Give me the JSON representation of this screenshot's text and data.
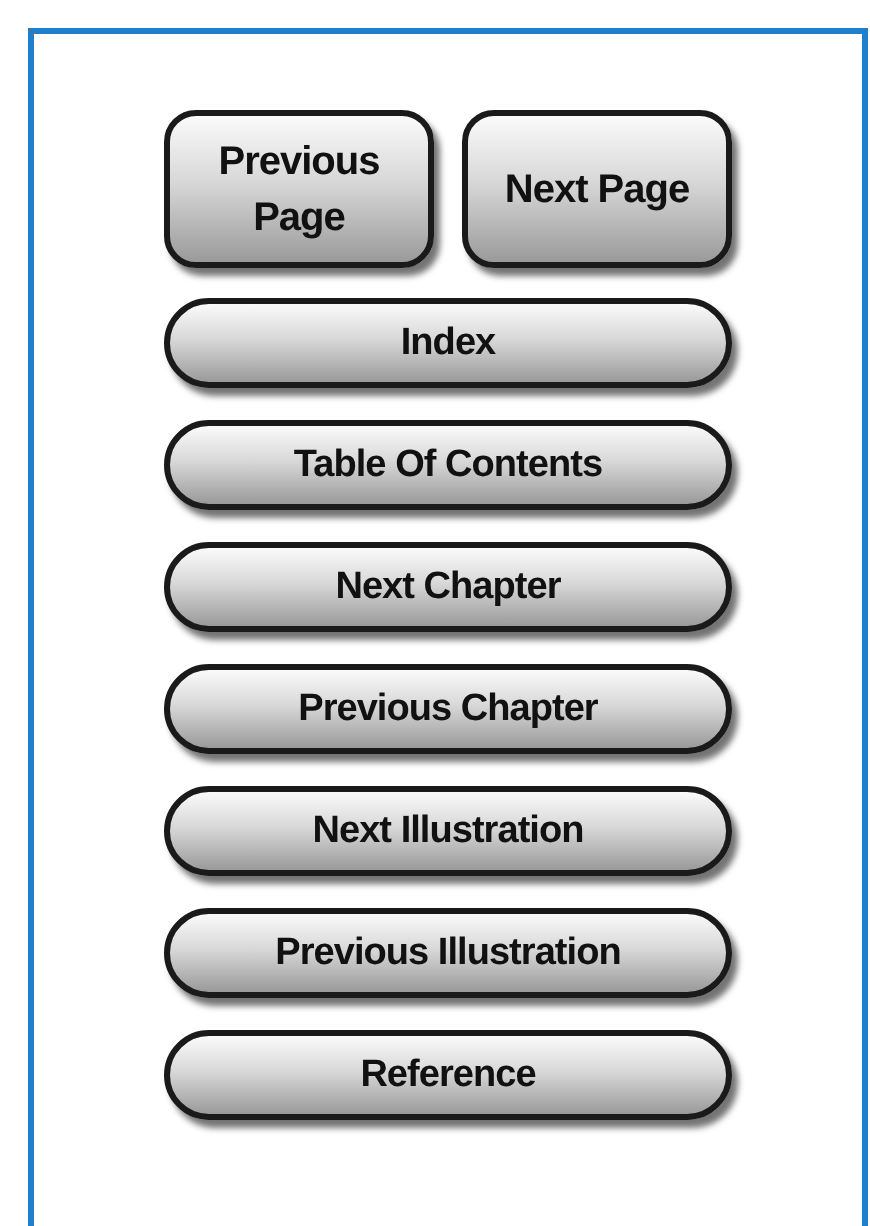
{
  "page_buttons": [
    {
      "label": "Previous Page"
    },
    {
      "label": "Next Page"
    }
  ],
  "nav_buttons": [
    {
      "label": "Index"
    },
    {
      "label": "Table Of Contents"
    },
    {
      "label": "Next Chapter"
    },
    {
      "label": "Previous Chapter"
    },
    {
      "label": "Next Illustration"
    },
    {
      "label": "Previous Illustration"
    },
    {
      "label": "Reference"
    }
  ]
}
